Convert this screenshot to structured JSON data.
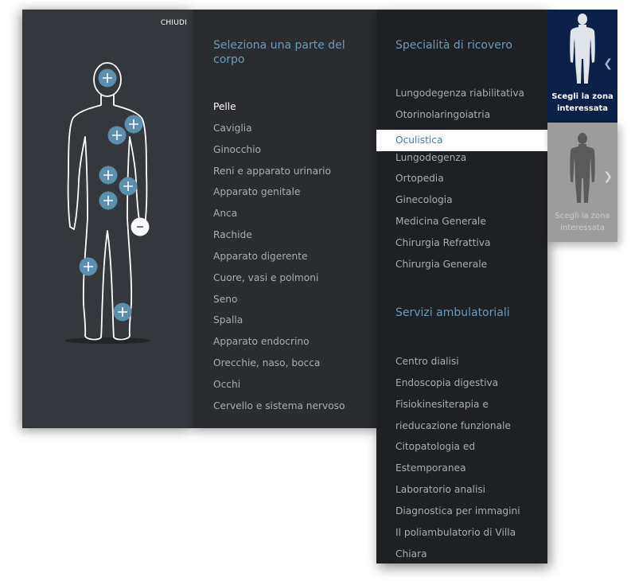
{
  "close_label": "CHIUDI",
  "parts": {
    "title": "Seleziona una parte del corpo",
    "items": [
      "Pelle",
      "Caviglia",
      "Ginocchio",
      "Reni e apparato urinario",
      "Apparato genitale",
      "Anca",
      "Rachide",
      "Apparato digerente",
      "Cuore, vasi e polmoni",
      "Seno",
      "Spalla",
      "Apparato endocrino",
      "Orecchie, naso, bocca",
      "Occhi",
      "Cervello e sistema nervoso"
    ],
    "selected_index": 0
  },
  "specialties": {
    "title": "Specialità di ricovero",
    "items": [
      "Lungodegenza riabilitativa",
      "Otorinolaringoiatria",
      "Oculistica",
      "Lungodegenza",
      "Ortopedia",
      "Ginecologia",
      "Medicina Generale",
      "Chirurgia Refrattiva",
      "Chirurgia Generale"
    ],
    "selected_index": 2
  },
  "services": {
    "title": "Servizi ambulatoriali",
    "items": [
      "Centro dialisi",
      "Endoscopia digestiva",
      "Fisiokinesiterapia e",
      "rieducazione funzionale",
      "Citopatologia ed",
      "Estemporanea",
      "Laboratorio analisi",
      "Diagnostica per immagini",
      "Il poliambulatorio di Villa",
      "Chiara"
    ]
  },
  "zone_selector": {
    "active_label": "Scegli la zona interessata",
    "inactive_label": "Scegli la zona interessata"
  },
  "colors": {
    "accent": "#6d9ab4",
    "hotspot": "#5b8fad",
    "zone_active_bg": "#0c2148"
  },
  "icons": {
    "hotspot": "plus-icon",
    "hotspot_open": "minus-icon",
    "zone_nav_prev": "chevron-left-icon",
    "zone_nav_next": "chevron-right-icon"
  }
}
